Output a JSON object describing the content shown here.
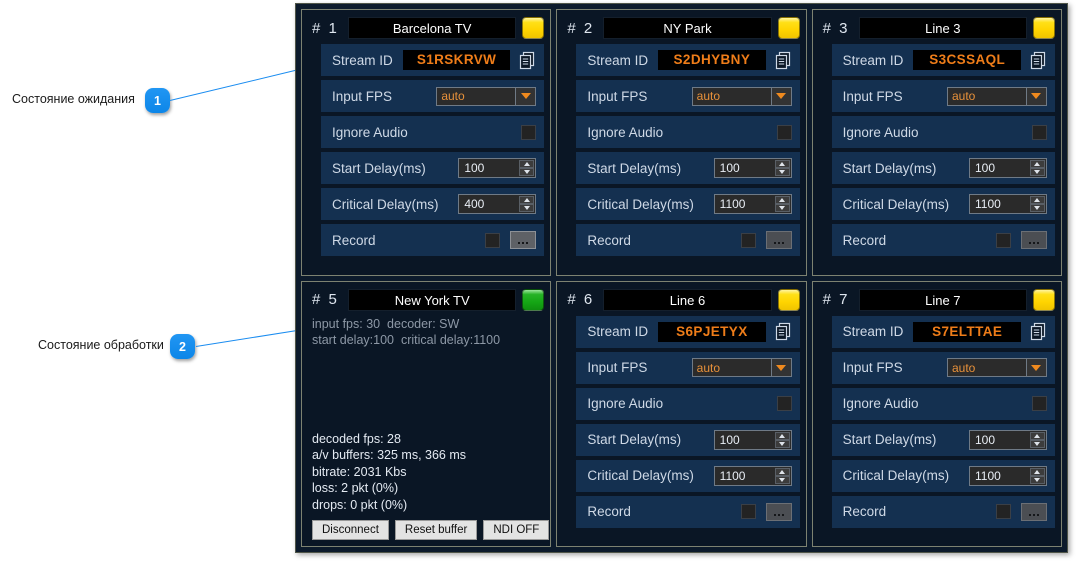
{
  "annotations": [
    {
      "id": "1",
      "label": "Состояние ожидания"
    },
    {
      "id": "2",
      "label": "Состояние обработки"
    }
  ],
  "labels": {
    "stream_id": "Stream ID",
    "input_fps": "Input FPS",
    "ignore_audio": "Ignore Audio",
    "start_delay": "Start Delay(ms)",
    "critical_delay": "Critical Delay(ms)",
    "record": "Record",
    "hash": "#"
  },
  "colors": {
    "led_idle": "#ffd400",
    "led_running": "#15a615",
    "stream_id_text": "#ef7d19",
    "row_bg": "#143050",
    "card_bg": "#0a1625",
    "window_bg": "#0c1a2b",
    "accent_blue": "#1a8cf0"
  },
  "cards": [
    {
      "number": "1",
      "title": "Barcelona TV",
      "led": "yellow",
      "state": "idle",
      "stream_id": "S1RSKRVW",
      "input_fps": "auto",
      "start_delay": "100",
      "critical_delay": "400",
      "record_enabled": true
    },
    {
      "number": "2",
      "title": "NY Park",
      "led": "yellow",
      "state": "idle",
      "stream_id": "S2DHYBNY",
      "input_fps": "auto",
      "start_delay": "100",
      "critical_delay": "1100",
      "record_enabled": false
    },
    {
      "number": "3",
      "title": "Line 3",
      "led": "yellow",
      "state": "idle",
      "stream_id": "S3CSSAQL",
      "input_fps": "auto",
      "start_delay": "100",
      "critical_delay": "1100",
      "record_enabled": false
    },
    {
      "number": "5",
      "title": "New York TV",
      "led": "green",
      "state": "running",
      "info_line_1": "input fps: 30  decoder: SW",
      "info_line_2": "start delay:100  critical delay:1100",
      "stats": [
        "decoded fps: 28",
        "a/v buffers: 325 ms, 366 ms",
        "bitrate: 2031 Kbs",
        "loss: 2 pkt (0%)",
        "drops: 0 pkt (0%)"
      ],
      "buttons": [
        "Disconnect",
        "Reset buffer",
        "NDI OFF"
      ]
    },
    {
      "number": "6",
      "title": "Line 6",
      "led": "yellow",
      "state": "idle",
      "stream_id": "S6PJETYX",
      "input_fps": "auto",
      "start_delay": "100",
      "critical_delay": "1100",
      "record_enabled": false
    },
    {
      "number": "7",
      "title": "Line 7",
      "led": "yellow",
      "state": "idle",
      "stream_id": "S7ELTTAE",
      "input_fps": "auto",
      "start_delay": "100",
      "critical_delay": "1100",
      "record_enabled": false
    }
  ]
}
